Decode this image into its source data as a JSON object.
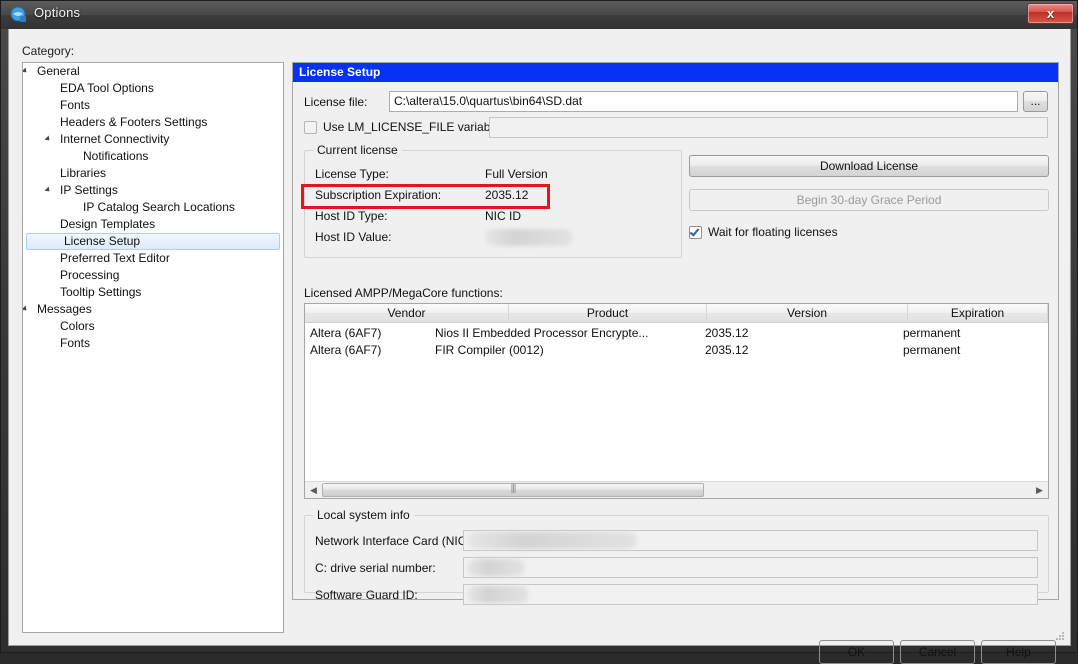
{
  "window": {
    "title": "Options",
    "icon": "quartus-app-icon",
    "close_label": "x"
  },
  "category": {
    "label": "Category:",
    "items": [
      {
        "label": "General",
        "indent": 0,
        "arrow": true,
        "selected": false
      },
      {
        "label": "EDA Tool Options",
        "indent": 1,
        "arrow": false,
        "selected": false
      },
      {
        "label": "Fonts",
        "indent": 1,
        "arrow": false,
        "selected": false
      },
      {
        "label": "Headers & Footers Settings",
        "indent": 1,
        "arrow": false,
        "selected": false
      },
      {
        "label": "Internet Connectivity",
        "indent": 1,
        "arrow": true,
        "selected": false
      },
      {
        "label": "Notifications",
        "indent": 2,
        "arrow": false,
        "selected": false
      },
      {
        "label": "Libraries",
        "indent": 1,
        "arrow": false,
        "selected": false
      },
      {
        "label": "IP Settings",
        "indent": 1,
        "arrow": true,
        "selected": false
      },
      {
        "label": "IP Catalog Search Locations",
        "indent": 2,
        "arrow": false,
        "selected": false
      },
      {
        "label": "Design Templates",
        "indent": 1,
        "arrow": false,
        "selected": false
      },
      {
        "label": "License Setup",
        "indent": 1,
        "arrow": false,
        "selected": true
      },
      {
        "label": "Preferred Text Editor",
        "indent": 1,
        "arrow": false,
        "selected": false
      },
      {
        "label": "Processing",
        "indent": 1,
        "arrow": false,
        "selected": false
      },
      {
        "label": "Tooltip Settings",
        "indent": 1,
        "arrow": false,
        "selected": false
      },
      {
        "label": "Messages",
        "indent": 0,
        "arrow": true,
        "selected": false
      },
      {
        "label": "Colors",
        "indent": 1,
        "arrow": false,
        "selected": false
      },
      {
        "label": "Fonts",
        "indent": 1,
        "arrow": false,
        "selected": false
      }
    ]
  },
  "panel": {
    "header": "License Setup",
    "license_file_label": "License file:",
    "license_file_value": "C:\\altera\\15.0\\quartus\\bin64\\SD.dat",
    "browse_label": "...",
    "lm_checkbox_label": "Use LM_LICENSE_FILE variable:",
    "lm_checkbox_checked": false,
    "lm_value": "",
    "current_license": {
      "title": "Current license",
      "rows": [
        {
          "label": "License Type:",
          "value": "Full Version",
          "highlight": false
        },
        {
          "label": "Subscription Expiration:",
          "value": "2035.12",
          "highlight": true
        },
        {
          "label": "Host ID Type:",
          "value": "NIC ID",
          "highlight": false
        },
        {
          "label": "Host ID Value:",
          "value": "",
          "highlight": false,
          "redacted": true
        }
      ]
    },
    "download_license_label": "Download License",
    "grace_period_label": "Begin 30-day Grace Period",
    "grace_period_disabled": true,
    "wait_floating_label": "Wait for floating licenses",
    "wait_floating_checked": true,
    "table": {
      "caption": "Licensed AMPP/MegaCore functions:",
      "columns": [
        "Vendor",
        "Product",
        "Version",
        "Expiration"
      ],
      "rows": [
        [
          "Altera (6AF7)",
          "Nios II Embedded Processor Encrypte...",
          "2035.12",
          "permanent"
        ],
        [
          "Altera (6AF7)",
          "FIR Compiler (0012)",
          "2035.12",
          "permanent"
        ]
      ]
    },
    "local_system": {
      "title": "Local system info",
      "rows": [
        {
          "label": "Network Interface Card (NIC) ID:",
          "value": "",
          "redacted": true
        },
        {
          "label": "C: drive serial number:",
          "value": "",
          "redacted": true
        },
        {
          "label": "Software Guard ID:",
          "value": "",
          "redacted": true
        }
      ]
    }
  },
  "footer": {
    "ok_label": "OK",
    "cancel_label": "Cancel",
    "help_label": "Help"
  },
  "colors": {
    "panel_header_blue": "#0532f4",
    "highlight_red": "#e8141b",
    "selection_blue": "#dcebfb"
  }
}
